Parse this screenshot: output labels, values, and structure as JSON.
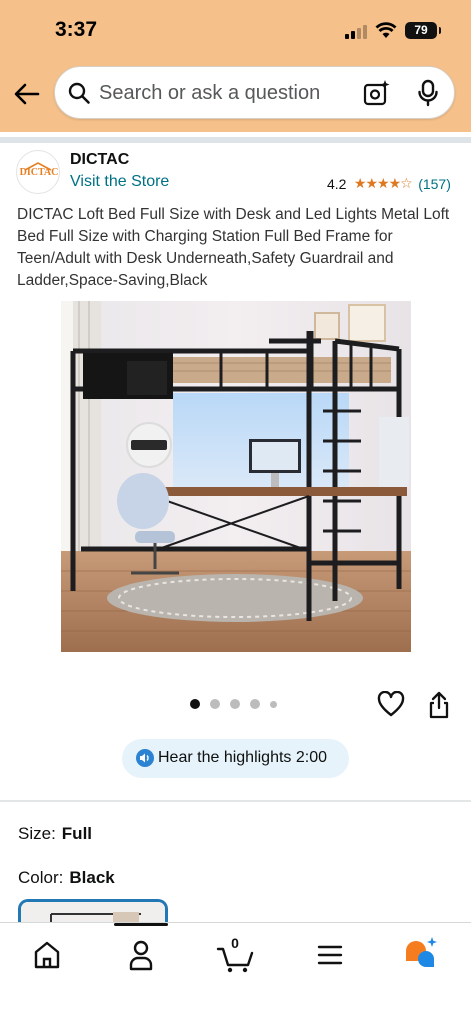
{
  "status_bar": {
    "time": "3:37",
    "battery": "79"
  },
  "search": {
    "placeholder": "Search or ask a question"
  },
  "brand": {
    "name": "DICTAC",
    "logo_text": "DICTAC",
    "visit_store_label": "Visit the Store",
    "rating": "4.2",
    "stars_filled": 4,
    "stars_total": 5,
    "review_count": "(157)"
  },
  "product": {
    "title": "DICTAC Loft Bed Full Size with Desk and Led Lights Metal Loft Bed Full Size with Charging Station Full Bed Frame for Teen/Adult with Desk Underneath,Safety Guardrail and Ladder,Space-Saving,Black",
    "image_dots": 5,
    "active_dot": 1
  },
  "highlights": {
    "label": "Hear the highlights 2:00"
  },
  "variants": {
    "size_key": "Size:",
    "size_value": "Full",
    "color_key": "Color:",
    "color_value": "Black"
  },
  "bottom_nav": {
    "items": [
      {
        "icon": "home-icon"
      },
      {
        "icon": "account-icon"
      },
      {
        "icon": "cart-icon",
        "count": "0"
      },
      {
        "icon": "menu-icon"
      },
      {
        "icon": "rufus-ai-icon"
      }
    ]
  },
  "colors": {
    "header_bg": "#f5c08a",
    "link": "#007185",
    "star": "#de7921",
    "swatch_border": "#2277b5",
    "highlights_bg": "#e7f3fb"
  }
}
